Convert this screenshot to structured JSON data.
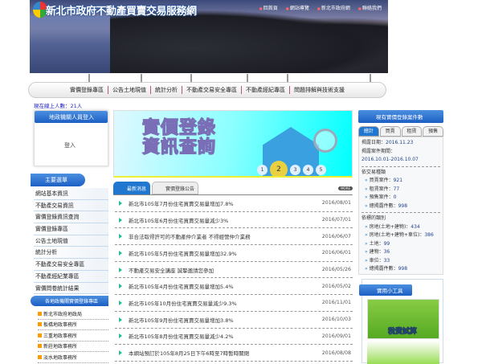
{
  "header": {
    "title": "新北市政府不動產買賣交易服務網",
    "links": [
      "回首頁",
      "網站導覽",
      "新北市政府網",
      "聯絡我們"
    ]
  },
  "nav": [
    "實價登錄專區",
    "公告土地現值",
    "統計分析",
    "不動產交易安全專區",
    "不動產經紀專區",
    "問題排解與技術支援"
  ],
  "online": "現在線上人數：21人",
  "login": {
    "title": "地政機關人員登入",
    "button": "登入"
  },
  "menu": {
    "title": "主要選單",
    "items": [
      "網站基本資訊",
      "不動產交易資訊",
      "實價登錄資訊查詢",
      "實價登錄專區",
      "公告土地現值",
      "統計分析",
      "不動產交易安全專區",
      "不動產經紀業專區",
      "實價問卷統計結果"
    ]
  },
  "offices": {
    "title": "各地政機關實價登錄專區",
    "items": [
      "新北市政府地政局",
      "板橋地政事務所",
      "三重地政事務所",
      "新莊地政事務所",
      "淡水地政事務所"
    ]
  },
  "promo": {
    "title_line1": "實價登錄",
    "title_line2": "資訊查詢",
    "pages": [
      "1",
      "2",
      "3",
      "4",
      "5"
    ],
    "active_page": "2"
  },
  "tabs": [
    "最新消息",
    "實價登錄公告"
  ],
  "more": "MORE",
  "news": [
    {
      "title": "新北市105年7月份住宅買賣交易量增加7.8%",
      "date": "2016/08/01"
    },
    {
      "title": "新北市105年6月份住宅買賣交易量減少3%",
      "date": "2016/07/01"
    },
    {
      "title": "非合法取得許可的不動產仲介業者 不得經營仲介業務",
      "date": "2016/06/07"
    },
    {
      "title": "新北市105年5月份住宅買賣交易量增加32.9%",
      "date": "2016/06/01"
    },
    {
      "title": "不動產交易安全講座 誠摯邀請您參加",
      "date": "2016/05/26"
    },
    {
      "title": "新北市105年4月份住宅買賣交易量增加5.4%",
      "date": "2016/05/02"
    },
    {
      "title": "新北市105年10月份住宅買賣交易量減少9.3%",
      "date": "2016/11/01"
    },
    {
      "title": "新北市105年9月份住宅買賣交易量增加3.8%",
      "date": "2016/10/03"
    },
    {
      "title": "新北市105年8月份住宅買賣交易量減少4.2%",
      "date": "2016/09/01"
    },
    {
      "title": "本網站預訂於105年8月25日下午6時至7時暫時關閉",
      "date": "2016/08/08"
    }
  ],
  "stats": {
    "title": "現有實價登錄案件數",
    "tabs": [
      "總計",
      "買賣",
      "租賃",
      "預售"
    ],
    "update_label": "揭露日期：",
    "update_date": "2016.11.23",
    "period_label": "揭露案件期間：",
    "period": "2016.10.01-2016.10.07",
    "by_type_title": "依交易種類",
    "by_type": [
      {
        "label": "買賣案件：",
        "value": "921"
      },
      {
        "label": "租賃案件：",
        "value": "77"
      },
      {
        "label": "預售案件：",
        "value": "0"
      },
      {
        "label": "總揭露件數：",
        "value": "998"
      }
    ],
    "by_target_title": "依標的類別",
    "by_target": [
      {
        "label": "房地(土地+建物)：",
        "value": "434"
      },
      {
        "label": "房地(土地+建物+車位)：",
        "value": "386"
      },
      {
        "label": "土地：",
        "value": "99"
      },
      {
        "label": "建物：",
        "value": "36"
      },
      {
        "label": "車位：",
        "value": "33"
      },
      {
        "label": "總揭露件數：",
        "value": "998"
      }
    ]
  },
  "tools": {
    "title": "實用小工具",
    "item1": "稅費試算"
  }
}
